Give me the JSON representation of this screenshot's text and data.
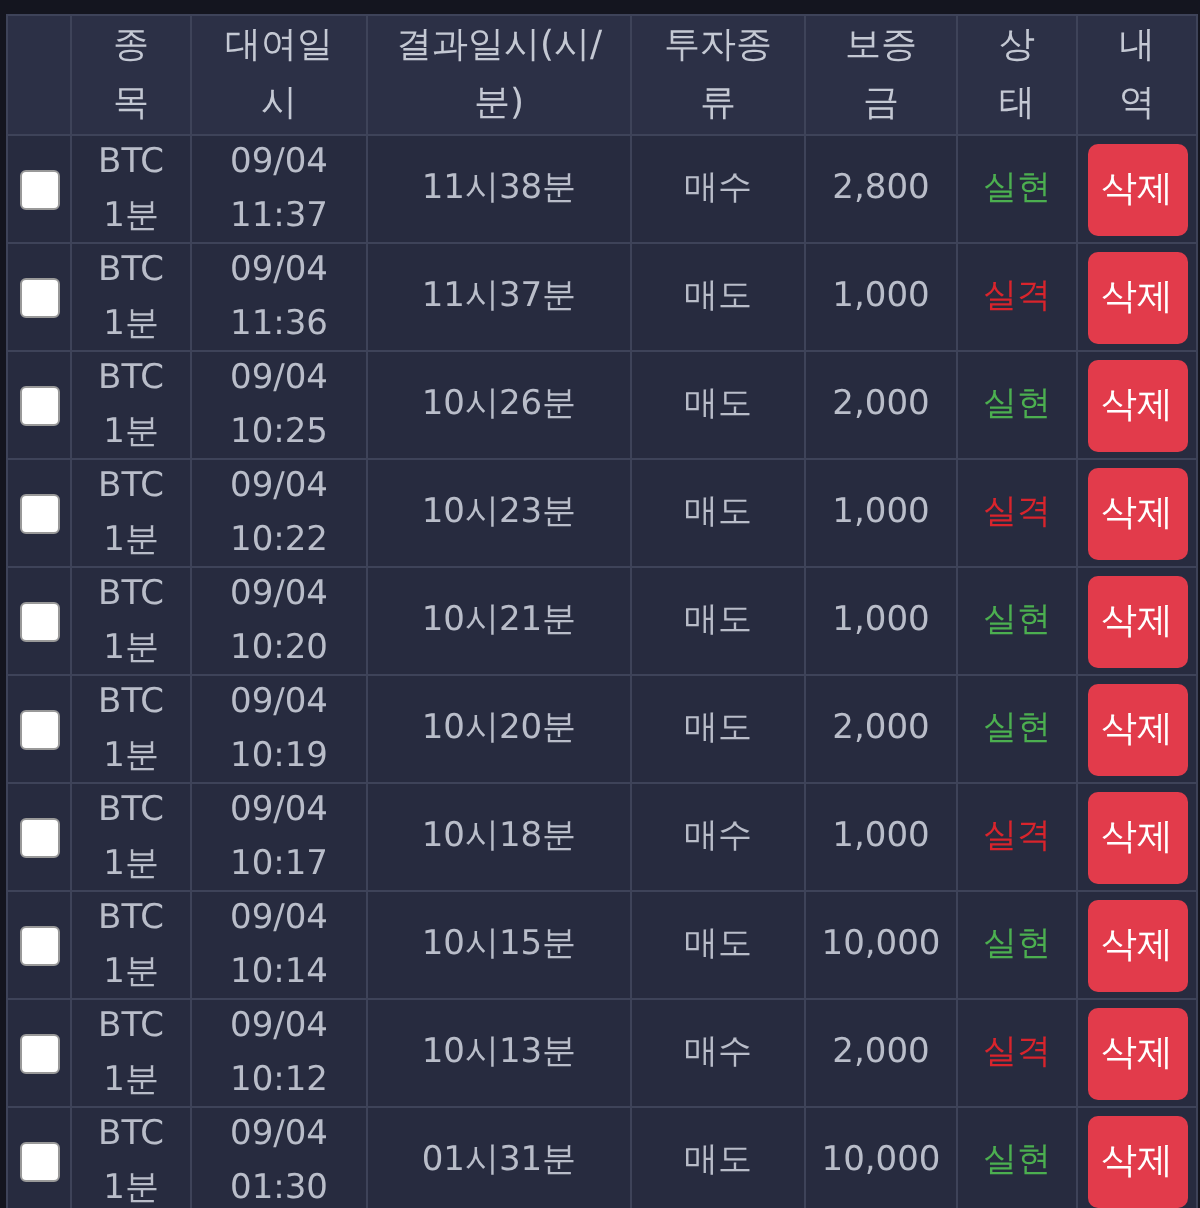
{
  "table": {
    "columns": [
      "종목",
      "대여일시",
      "결과일시(시/분)",
      "투자종류",
      "보증금",
      "상태",
      "내역"
    ],
    "rows": [
      {
        "checked": false,
        "item": "BTC 1분",
        "rented_at": "09/04 11:37",
        "result_time": "11시38분",
        "type": "매수",
        "deposit": "2,800",
        "status": {
          "label": "실현",
          "color": "#4caf50"
        },
        "action": "삭제"
      },
      {
        "checked": false,
        "item": "BTC 1분",
        "rented_at": "09/04 11:36",
        "result_time": "11시37분",
        "type": "매도",
        "deposit": "1,000",
        "status": {
          "label": "실격",
          "color": "#d8242c"
        },
        "action": "삭제"
      },
      {
        "checked": false,
        "item": "BTC 1분",
        "rented_at": "09/04 10:25",
        "result_time": "10시26분",
        "type": "매도",
        "deposit": "2,000",
        "status": {
          "label": "실현",
          "color": "#4caf50"
        },
        "action": "삭제"
      },
      {
        "checked": false,
        "item": "BTC 1분",
        "rented_at": "09/04 10:22",
        "result_time": "10시23분",
        "type": "매도",
        "deposit": "1,000",
        "status": {
          "label": "실격",
          "color": "#d8242c"
        },
        "action": "삭제"
      },
      {
        "checked": false,
        "item": "BTC 1분",
        "rented_at": "09/04 10:20",
        "result_time": "10시21분",
        "type": "매도",
        "deposit": "1,000",
        "status": {
          "label": "실현",
          "color": "#4caf50"
        },
        "action": "삭제"
      },
      {
        "checked": false,
        "item": "BTC 1분",
        "rented_at": "09/04 10:19",
        "result_time": "10시20분",
        "type": "매도",
        "deposit": "2,000",
        "status": {
          "label": "실현",
          "color": "#4caf50"
        },
        "action": "삭제"
      },
      {
        "checked": false,
        "item": "BTC 1분",
        "rented_at": "09/04 10:17",
        "result_time": "10시18분",
        "type": "매수",
        "deposit": "1,000",
        "status": {
          "label": "실격",
          "color": "#d8242c"
        },
        "action": "삭제"
      },
      {
        "checked": false,
        "item": "BTC 1분",
        "rented_at": "09/04 10:14",
        "result_time": "10시15분",
        "type": "매도",
        "deposit": "10,000",
        "status": {
          "label": "실현",
          "color": "#4caf50"
        },
        "action": "삭제"
      },
      {
        "checked": false,
        "item": "BTC 1분",
        "rented_at": "09/04 10:12",
        "result_time": "10시13분",
        "type": "매수",
        "deposit": "2,000",
        "status": {
          "label": "실격",
          "color": "#d8242c"
        },
        "action": "삭제"
      },
      {
        "checked": false,
        "item": "BTC 1분",
        "rented_at": "09/04 01:30",
        "result_time": "01시31분",
        "type": "매도",
        "deposit": "10,000",
        "status": {
          "label": "실현",
          "color": "#4caf50"
        },
        "action": "삭제"
      }
    ]
  }
}
